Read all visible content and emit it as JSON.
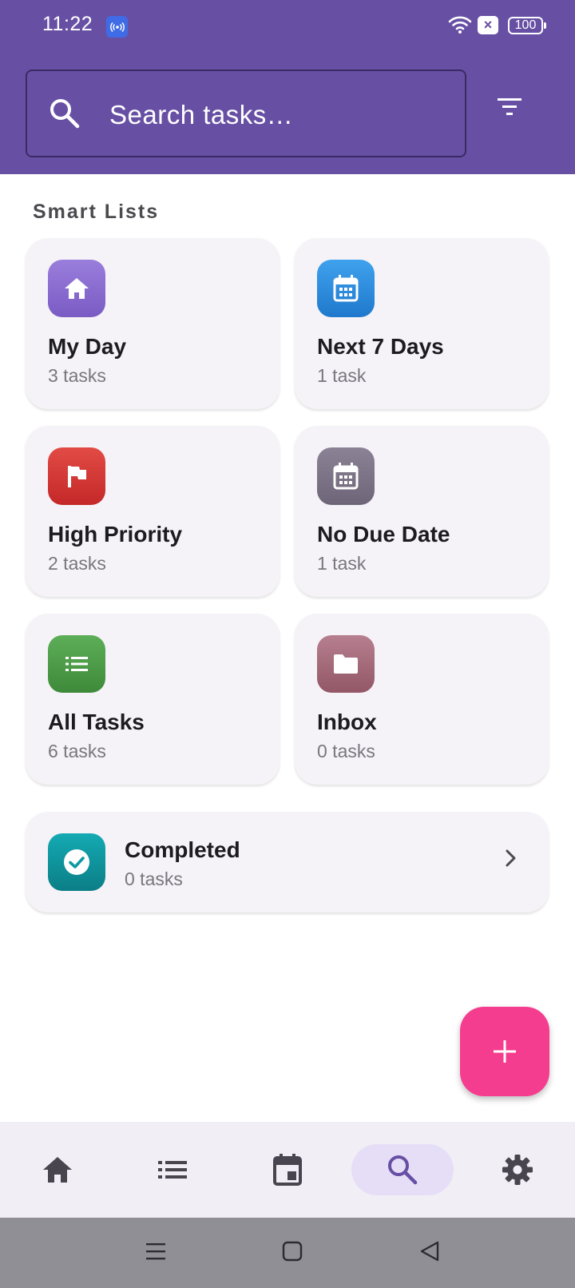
{
  "status_bar": {
    "time": "11:22",
    "battery": "100"
  },
  "search": {
    "placeholder": "Search tasks…"
  },
  "section": {
    "title": "Smart Lists"
  },
  "smart_lists": [
    {
      "title": "My Day",
      "count": "3 tasks",
      "icon": "home-icon",
      "color": "#8E6FD1"
    },
    {
      "title": "Next 7 Days",
      "count": "1 task",
      "icon": "calendar-icon",
      "color": "#2C8DDE"
    },
    {
      "title": "High Priority",
      "count": "2 tasks",
      "icon": "flag-icon",
      "color": "#D63A3A"
    },
    {
      "title": "No Due Date",
      "count": "1 task",
      "icon": "calendar-icon",
      "color": "#7D7487"
    },
    {
      "title": "All Tasks",
      "count": "6 tasks",
      "icon": "list-icon",
      "color": "#4E9F4A"
    },
    {
      "title": "Inbox",
      "count": "0 tasks",
      "icon": "folder-icon",
      "color": "#A86F7F"
    }
  ],
  "completed": {
    "title": "Completed",
    "count": "0 tasks",
    "icon": "check-circle-icon",
    "color": "#0F9AA3"
  },
  "fab": {
    "icon": "plus-icon",
    "color": "#F53D8F"
  },
  "bottom_nav": {
    "items": [
      {
        "name": "home",
        "icon": "home-icon",
        "active": false
      },
      {
        "name": "lists",
        "icon": "list-icon",
        "active": false
      },
      {
        "name": "calendar",
        "icon": "calendar-icon",
        "active": false
      },
      {
        "name": "search",
        "icon": "search-icon",
        "active": true
      },
      {
        "name": "settings",
        "icon": "gear-icon",
        "active": false
      }
    ]
  },
  "theme": {
    "primary": "#6750A4",
    "card_bg": "#F5F3F7",
    "nav_bg": "#F1EEF5",
    "nav_active_bg": "#E6DEF7"
  }
}
